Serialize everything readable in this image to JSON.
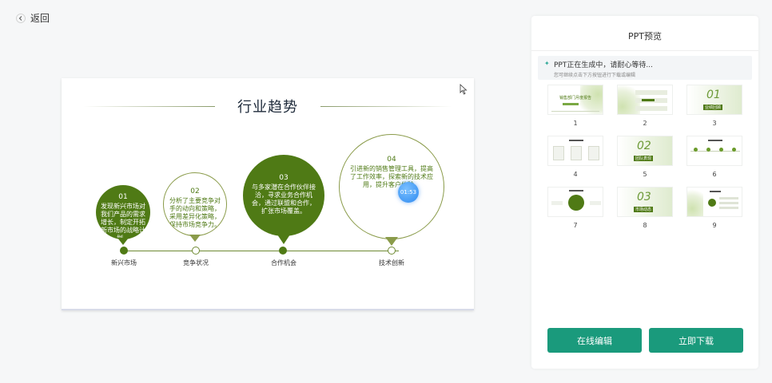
{
  "nav": {
    "back_label": "返回"
  },
  "slide": {
    "title": "行业趋势",
    "items": [
      {
        "num": "01",
        "text": "发现新兴市场对我们产品的需求增长，制定开拓新市场的战略计划。",
        "label": "新兴市场"
      },
      {
        "num": "02",
        "text": "分析了主要竞争对手的动向和策略，采用差异化策略，保持市场竞争力。",
        "label": "竞争状况"
      },
      {
        "num": "03",
        "text": "与多家潜在合作伙伴接洽，寻求业务合作机会，通过联盟和合作，扩张市场覆盖。",
        "label": "合作机会"
      },
      {
        "num": "04",
        "text": "引进新的销售管理工具，提高了工作效率，探索新的技术应用，提升客户体验。",
        "label": "技术创新"
      }
    ],
    "timer": "01:53"
  },
  "panel": {
    "title": "PPT预览",
    "status_message": "PPT正在生成中，请耐心等待...",
    "status_sub": "您可继续点击下方按钮进行下载或编辑",
    "thumbnails": [
      "1",
      "2",
      "3",
      "4",
      "5",
      "6",
      "7",
      "8",
      "9"
    ],
    "thumb_texts": {
      "t1_title": "销售部门月度报告",
      "t3_num": "01",
      "t3_chip": "业绩回顾",
      "t5_num": "02",
      "t5_chip": "团队表现",
      "t8_num": "03",
      "t8_chip": "市场动态"
    },
    "edit_button": "在线编辑",
    "download_button": "立即下载"
  },
  "colors": {
    "accent": "#1a9a7c",
    "slide_green": "#4f7a15",
    "timer_blue": "#2f8af0"
  }
}
